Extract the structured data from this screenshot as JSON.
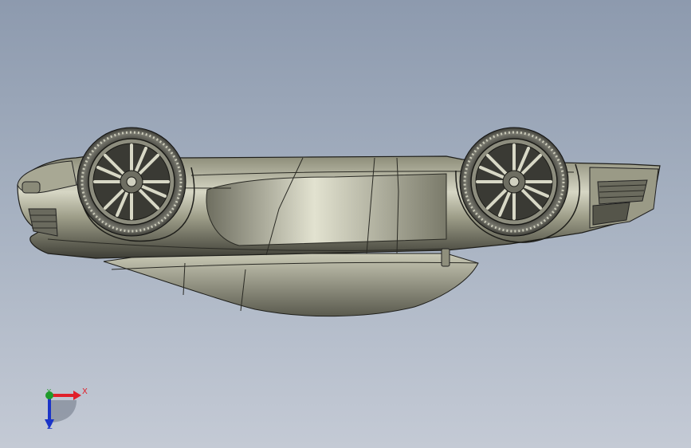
{
  "viewport": {
    "background_top": "#8d9aae",
    "background_bottom": "#c4cad5",
    "model": "car-upside-down",
    "body_color": "#b4b49a"
  },
  "triad": {
    "x_label": "X",
    "y_label": "Y",
    "z_label": "Z",
    "x_color": "#e0202a",
    "y_color": "#1f9a2a",
    "z_color": "#1b34c8"
  }
}
